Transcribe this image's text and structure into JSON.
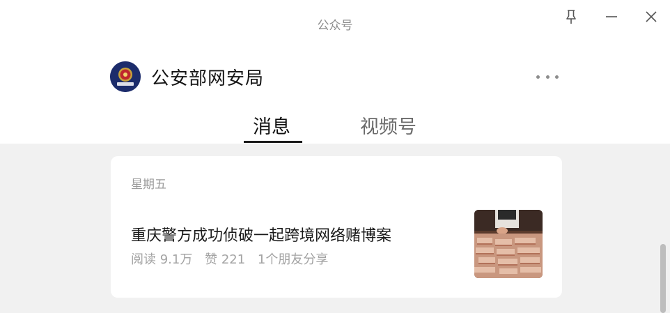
{
  "window": {
    "title": "公众号",
    "buttons": {
      "pin": "pin-icon",
      "minimize": "minimize-icon",
      "close": "close-icon"
    }
  },
  "account": {
    "name": "公安部网安局",
    "avatar_icon": "police-emblem-icon",
    "more_icon": "more-dots-icon"
  },
  "tabs": [
    {
      "label": "消息",
      "active": true
    },
    {
      "label": "视频号",
      "active": false
    }
  ],
  "feed": {
    "date": "星期五",
    "article": {
      "title": "重庆警方成功侦破一起跨境网络赌博案",
      "stats": {
        "reads": "阅读 9.1万",
        "likes": "赞 221",
        "shares": "1个朋友分享"
      },
      "thumbnail_icon": "cash-stacks-photo"
    }
  },
  "colors": {
    "content_bg": "#f1f1f1",
    "card_bg": "#ffffff",
    "avatar_bg": "#1c2c6b",
    "muted_text": "#a3a3a3"
  }
}
